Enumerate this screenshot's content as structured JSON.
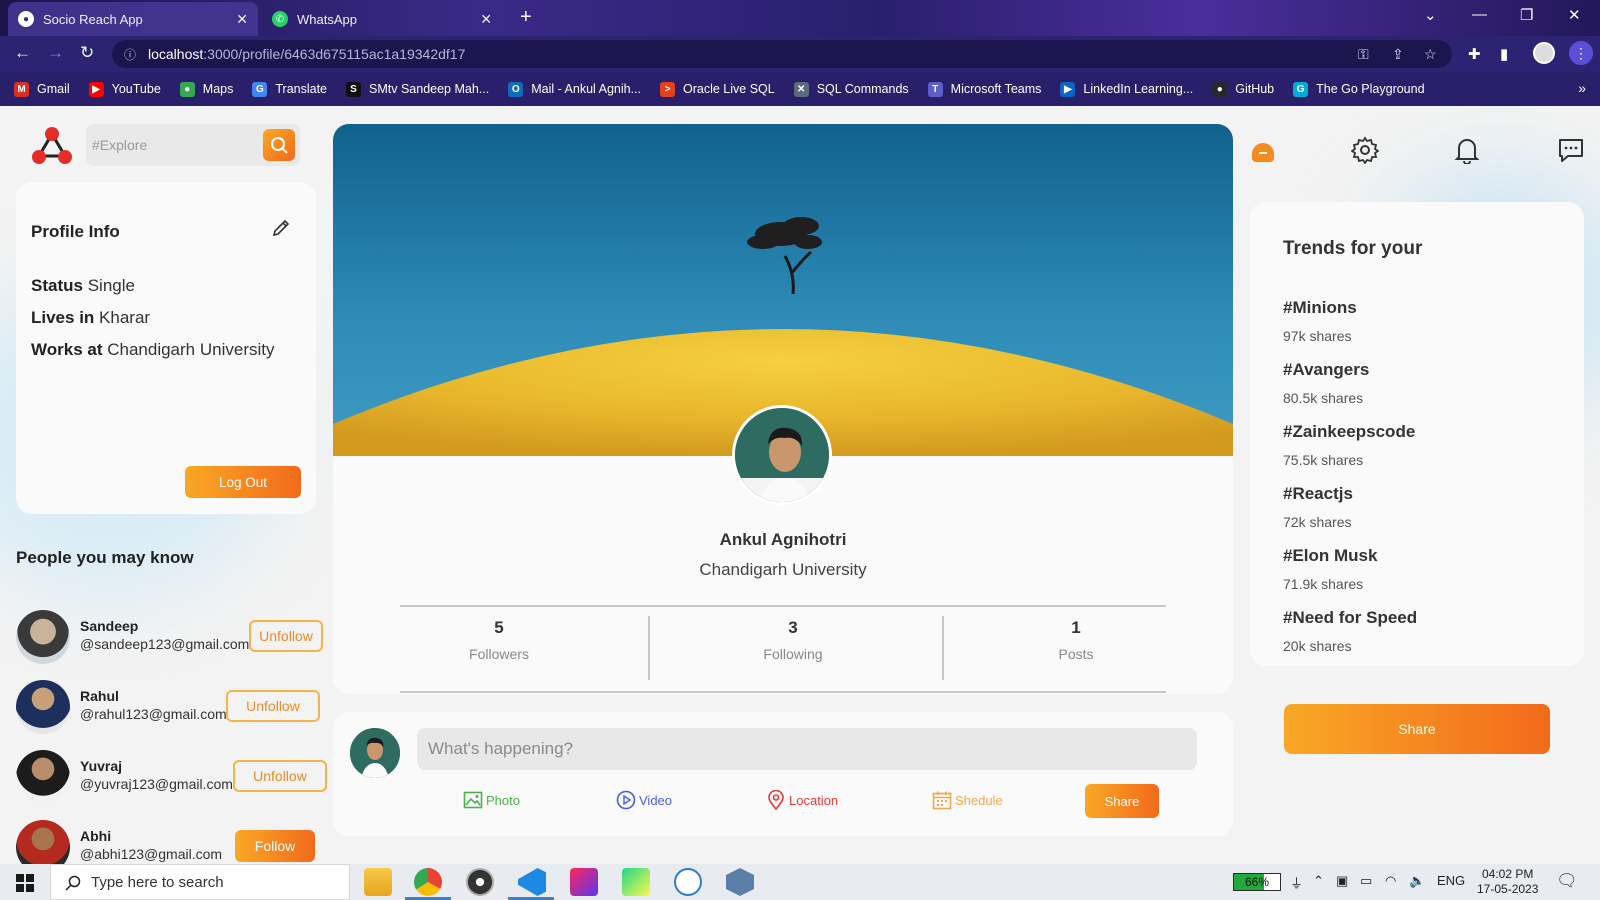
{
  "browser": {
    "tabs": [
      {
        "title": "Socio Reach App",
        "active": true
      },
      {
        "title": "WhatsApp",
        "active": false
      }
    ],
    "url_host": "localhost",
    "url_path": ":3000/profile/6463d675115ac1a19342df17",
    "bookmarks": [
      {
        "label": "Gmail",
        "color": "#d93025",
        "glyph": "M"
      },
      {
        "label": "YouTube",
        "color": "#ff0000",
        "glyph": "▶"
      },
      {
        "label": "Maps",
        "color": "#34a853",
        "glyph": "●"
      },
      {
        "label": "Translate",
        "color": "#4285f4",
        "glyph": "G"
      },
      {
        "label": "SMtv Sandeep Mah...",
        "color": "#111111",
        "glyph": "S"
      },
      {
        "label": "Mail - Ankul Agnih...",
        "color": "#0f6cbd",
        "glyph": "O"
      },
      {
        "label": "Oracle Live SQL",
        "color": "#e2431e",
        "glyph": ">"
      },
      {
        "label": "SQL Commands",
        "color": "#5a6b7b",
        "glyph": "✕"
      },
      {
        "label": "Microsoft Teams",
        "color": "#5b5fc7",
        "glyph": "T"
      },
      {
        "label": "LinkedIn Learning...",
        "color": "#0a66c2",
        "glyph": "▶"
      },
      {
        "label": "GitHub",
        "color": "#24292f",
        "glyph": "●"
      },
      {
        "label": "The Go Playground",
        "color": "#00add8",
        "glyph": "G"
      }
    ]
  },
  "header": {
    "search_placeholder": "#Explore"
  },
  "profile_info": {
    "title": "Profile Info",
    "rows": [
      {
        "label": "Status",
        "value": "Single"
      },
      {
        "label": "Lives in",
        "value": "Kharar"
      },
      {
        "label": "Works at",
        "value": "Chandigarh University"
      }
    ],
    "logout_label": "Log Out"
  },
  "people": {
    "title": "People you may know",
    "list": [
      {
        "name": "Sandeep",
        "email": "@sandeep123@gmail.com",
        "action": "Unfollow"
      },
      {
        "name": "Rahul",
        "email": "@rahul123@gmail.com",
        "action": "Unfollow"
      },
      {
        "name": "Yuvraj",
        "email": "@yuvraj123@gmail.com",
        "action": "Unfollow"
      },
      {
        "name": "Abhi",
        "email": "@abhi123@gmail.com",
        "action": "Follow"
      }
    ]
  },
  "profile": {
    "name": "Ankul Agnihotri",
    "work": "Chandigarh University",
    "stats": [
      {
        "value": "5",
        "label": "Followers"
      },
      {
        "value": "3",
        "label": "Following"
      },
      {
        "value": "1",
        "label": "Posts"
      }
    ]
  },
  "post": {
    "placeholder": "What's happening?",
    "options": [
      {
        "label": "Photo",
        "color": "#4caf50"
      },
      {
        "label": "Video",
        "color": "#4a5ee0"
      },
      {
        "label": "Location",
        "color": "#e53935"
      },
      {
        "label": "Shedule",
        "color": "#f0a94a"
      }
    ],
    "share_label": "Share"
  },
  "trends": {
    "title": "Trends for your",
    "items": [
      {
        "tag": "#Minions",
        "shares": "97k shares"
      },
      {
        "tag": "#Avangers",
        "shares": "80.5k shares"
      },
      {
        "tag": "#Zainkeepscode",
        "shares": "75.5k shares"
      },
      {
        "tag": "#Reactjs",
        "shares": "72k shares"
      },
      {
        "tag": "#Elon Musk",
        "shares": "71.9k shares"
      },
      {
        "tag": "#Need for Speed",
        "shares": "20k shares"
      }
    ],
    "share_label": "Share"
  },
  "taskbar": {
    "search_placeholder": "Type here to search",
    "battery": "66%",
    "battery_level": 0.66,
    "language": "ENG",
    "time": "04:02 PM",
    "date": "17-05-2023"
  },
  "colors": {
    "accent_start": "#f9a825",
    "accent_end": "#f26a1b"
  }
}
